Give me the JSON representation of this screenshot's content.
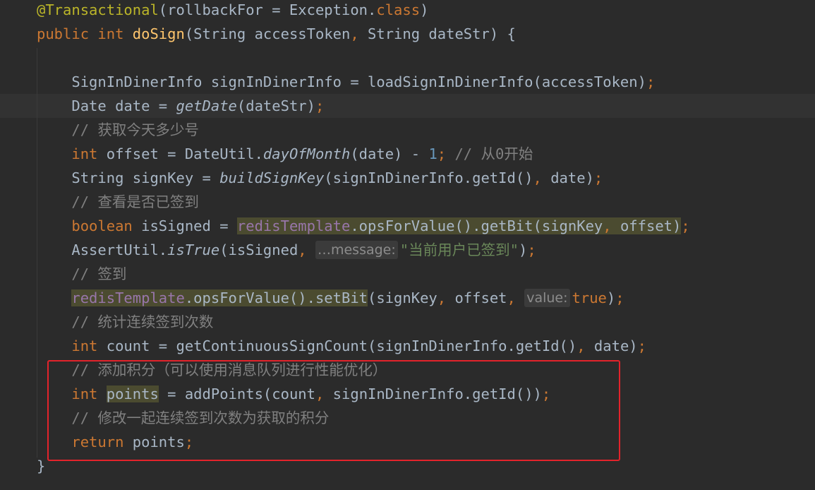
{
  "editor": {
    "lines": [
      {
        "tokens": [
          {
            "t": "@Transactional",
            "c": "ann"
          },
          {
            "t": "(rollbackFor = Exception."
          },
          {
            "t": "class",
            "c": "kw"
          },
          {
            "t": ")"
          }
        ]
      },
      {
        "tokens": [
          {
            "t": "public ",
            "c": "kw"
          },
          {
            "t": "int ",
            "c": "kw"
          },
          {
            "t": "doSign",
            "c": "fn"
          },
          {
            "t": "(String accessToken"
          },
          {
            "t": ", ",
            "c": "kw"
          },
          {
            "t": "String dateStr) {"
          }
        ]
      },
      {
        "tokens": []
      },
      {
        "tokens": [
          {
            "t": "    SignInDinerInfo signInDinerInfo = loadSignInDinerInfo(accessToken)"
          },
          {
            "t": ";",
            "c": "kw"
          }
        ]
      },
      {
        "current": true,
        "tokens": [
          {
            "t": "    Date date = "
          },
          {
            "t": "getDate",
            "c": "it"
          },
          {
            "t": "(dateStr)"
          },
          {
            "t": ";",
            "c": "kw"
          }
        ]
      },
      {
        "tokens": [
          {
            "t": "    // 获取今天多少号",
            "c": "cm"
          }
        ]
      },
      {
        "tokens": [
          {
            "t": "    "
          },
          {
            "t": "int ",
            "c": "kw"
          },
          {
            "t": "offset = DateUtil."
          },
          {
            "t": "dayOfMonth",
            "c": "it"
          },
          {
            "t": "(date) - "
          },
          {
            "t": "1",
            "c": "num"
          },
          {
            "t": "; ",
            "c": "kw"
          },
          {
            "t": "// 从0开始",
            "c": "cm"
          }
        ]
      },
      {
        "tokens": [
          {
            "t": "    String signKey = "
          },
          {
            "t": "buildSignKey",
            "c": "it"
          },
          {
            "t": "(signInDinerInfo.getId()"
          },
          {
            "t": ", ",
            "c": "kw"
          },
          {
            "t": "date)"
          },
          {
            "t": ";",
            "c": "kw"
          }
        ]
      },
      {
        "tokens": [
          {
            "t": "    // 查看是否已签到",
            "c": "cm"
          }
        ]
      },
      {
        "tokens": [
          {
            "t": "    "
          },
          {
            "t": "boolean ",
            "c": "kw"
          },
          {
            "t": "isSigned = "
          },
          {
            "t": "redisTemplate",
            "c": "field hl"
          },
          {
            "t": ".opsForValue().getBit(signKey",
            "c": "hl"
          },
          {
            "t": ", ",
            "c": "kw hl"
          },
          {
            "t": "offset)",
            "c": "hl"
          },
          {
            "t": ";",
            "c": "kw"
          }
        ]
      },
      {
        "tokens": [
          {
            "t": "    AssertUtil."
          },
          {
            "t": "isTrue",
            "c": "it"
          },
          {
            "t": "(isSigned"
          },
          {
            "t": ", ",
            "c": "kw"
          },
          {
            "hint": "…message:"
          },
          {
            "t": "\"当前用户已签到\"",
            "c": "str"
          },
          {
            "t": ")"
          },
          {
            "t": ";",
            "c": "kw"
          }
        ]
      },
      {
        "tokens": [
          {
            "t": "    // 签到",
            "c": "cm"
          }
        ]
      },
      {
        "tokens": [
          {
            "t": "    "
          },
          {
            "t": "redisTemplate",
            "c": "field hl"
          },
          {
            "t": ".opsForValue().setBit",
            "c": "hl"
          },
          {
            "t": "(signKey"
          },
          {
            "t": ", ",
            "c": "kw"
          },
          {
            "t": "offset"
          },
          {
            "t": ", ",
            "c": "kw"
          },
          {
            "hint": "value:"
          },
          {
            "t": "true",
            "c": "kw"
          },
          {
            "t": ")"
          },
          {
            "t": ";",
            "c": "kw"
          }
        ]
      },
      {
        "tokens": [
          {
            "t": "    // 统计连续签到次数",
            "c": "cm"
          }
        ]
      },
      {
        "tokens": [
          {
            "t": "    "
          },
          {
            "t": "int ",
            "c": "kw"
          },
          {
            "t": "count = getContinuousSignCount(signInDinerInfo.getId()"
          },
          {
            "t": ", ",
            "c": "kw"
          },
          {
            "t": "date)"
          },
          {
            "t": ";",
            "c": "kw"
          }
        ]
      },
      {
        "tokens": [
          {
            "t": "    // 添加积分（可以使用消息队列进行性能优化）",
            "c": "cm"
          }
        ]
      },
      {
        "tokens": [
          {
            "t": "    "
          },
          {
            "t": "int ",
            "c": "kw"
          },
          {
            "t": "points",
            "c": "hl"
          },
          {
            "t": " = addPoints(count"
          },
          {
            "t": ", ",
            "c": "kw"
          },
          {
            "t": "signInDinerInfo.getId())"
          },
          {
            "t": ";",
            "c": "kw"
          }
        ]
      },
      {
        "tokens": [
          {
            "t": "    // 修改一起连续签到次数为获取的积分",
            "c": "cm"
          }
        ]
      },
      {
        "tokens": [
          {
            "t": "    "
          },
          {
            "t": "return ",
            "c": "kw"
          },
          {
            "t": "points"
          },
          {
            "t": ";",
            "c": "kw"
          }
        ]
      },
      {
        "tokens": [
          {
            "t": "}"
          }
        ]
      }
    ]
  },
  "colors": {
    "background": "#2b2b2b",
    "keyword": "#cc7832",
    "annotation": "#bbb529",
    "function": "#ffc66d",
    "string": "#6a8759",
    "number": "#6897bb",
    "comment": "#808080",
    "field": "#9876aa",
    "highlight_box": "#e3232b"
  }
}
